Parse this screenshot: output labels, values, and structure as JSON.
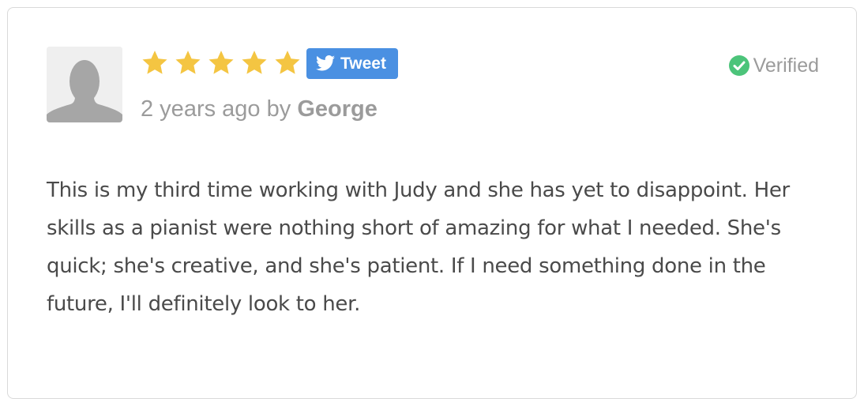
{
  "review": {
    "rating": 5,
    "rating_max": 5,
    "tweet_label": "Tweet",
    "verified_label": "Verified",
    "time_ago": "2 years ago",
    "by_text": "by",
    "author": "George",
    "text": "This is my third time working with Judy and she has yet to disappoint. Her skills as a pianist were nothing short of amazing for what I needed. She's quick; she's creative, and she's patient. If I need something done in the future, I'll definitely look to her."
  },
  "colors": {
    "star": "#f4c542",
    "tweet_button": "#4a90e2",
    "verified_check": "#4cc47a",
    "meta_text": "#9b9b9b",
    "body_text": "#4a4a4a"
  },
  "icons": {
    "avatar": "person-silhouette-icon",
    "star": "star-icon",
    "tweet": "twitter-bird-icon",
    "verified": "check-circle-icon"
  }
}
